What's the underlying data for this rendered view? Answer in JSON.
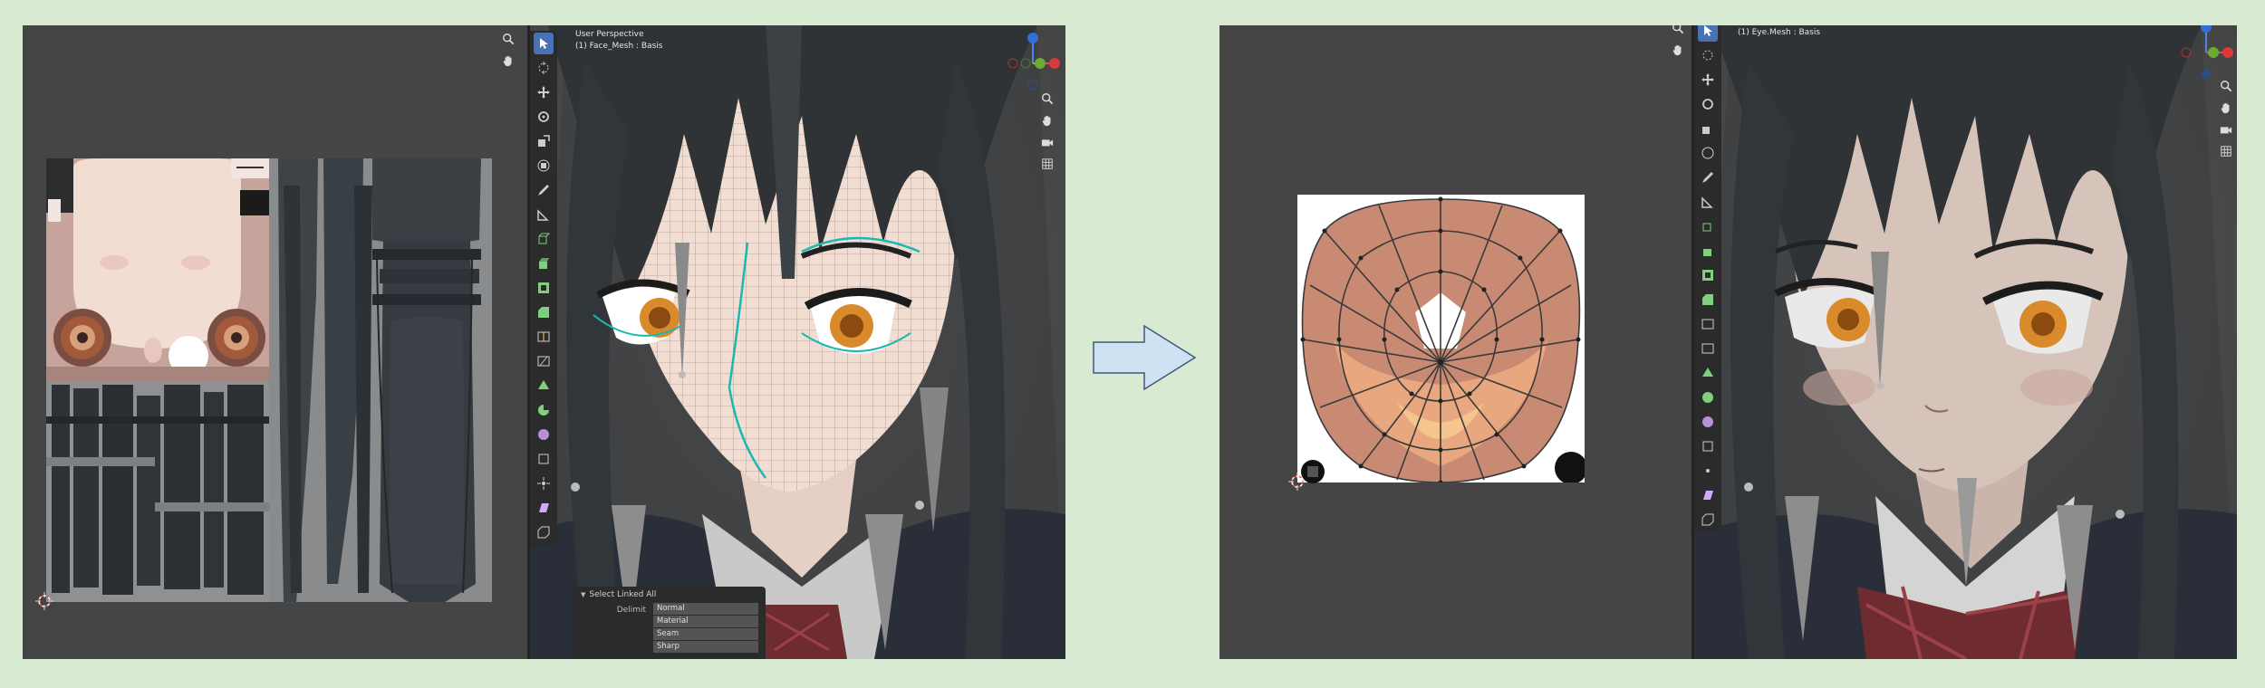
{
  "left_screenshot": {
    "viewport_header": {
      "view_name": "User Perspective",
      "object_info": "(1) Face_Mesh : Basis"
    },
    "redo_panel": {
      "title": "Select Linked All",
      "delimit_label": "Delimit",
      "delimit_options": [
        "Normal",
        "Material",
        "Seam",
        "Sharp"
      ]
    }
  },
  "right_screenshot": {
    "viewport_header": {
      "object_info": "(1) Eye.Mesh : Basis"
    }
  },
  "colors": {
    "page_background": "#d9ead3",
    "active_tool": "#4772b3",
    "uv_seam": "#19b9b1",
    "skin": "#f2ddd2",
    "hair": "#2f3336",
    "iris": "#d98a2a",
    "arrow_fill": "#cfe2f3",
    "arrow_stroke": "#41597a"
  },
  "icons": {
    "toolbar": [
      "select-box-icon",
      "cursor-icon",
      "move-icon",
      "rotate-icon",
      "scale-icon",
      "transform-icon",
      "annotate-icon",
      "measure-icon",
      "add-cube-icon",
      "extrude-icon",
      "inset-icon",
      "bevel-icon",
      "loop-cut-icon",
      "knife-icon",
      "poly-build-icon",
      "spin-icon",
      "smooth-icon",
      "edge-slide-icon",
      "shrink-fatten-icon",
      "shear-icon",
      "rip-icon"
    ],
    "navigation": [
      "zoom-icon",
      "hand-icon",
      "camera-icon",
      "grid-icon"
    ],
    "transition": "right-arrow-icon"
  }
}
